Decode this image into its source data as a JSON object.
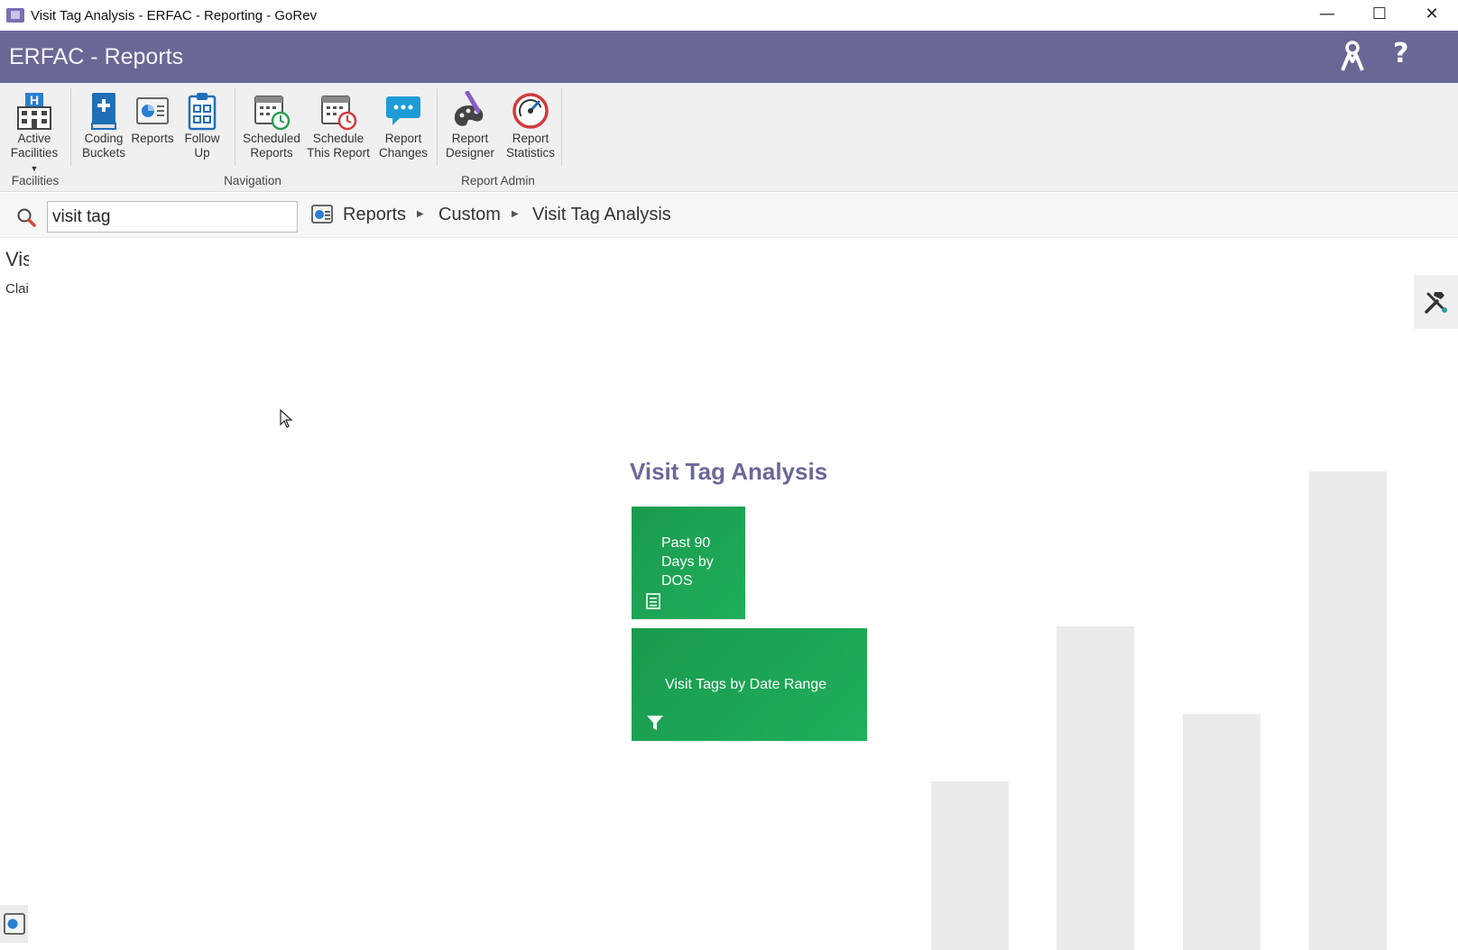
{
  "window": {
    "title": "Visit Tag Analysis - ERFAC - Reporting - GoRev",
    "controls": {
      "minimize": "—",
      "maximize": "☐",
      "close": "✕"
    }
  },
  "app_header": {
    "title": "ERFAC - Reports",
    "icons": [
      "users-icon",
      "help-icon"
    ],
    "help_glyph": "?"
  },
  "ribbon": {
    "buttons": [
      {
        "label": "Active\nFacilities",
        "icon": "hospital-icon",
        "has_dropdown": true
      },
      {
        "label": "Coding\nBuckets",
        "icon": "medical-book-icon"
      },
      {
        "label": "Reports",
        "icon": "report-icon"
      },
      {
        "label": "Follow\nUp",
        "icon": "clipboard-icon"
      },
      {
        "label": "Scheduled\nReports",
        "icon": "calendar-clock-green-icon"
      },
      {
        "label": "Schedule\nThis Report",
        "icon": "calendar-clock-red-icon"
      },
      {
        "label": "Report\nChanges",
        "icon": "chat-bubble-icon"
      },
      {
        "label": "Report\nDesigner",
        "icon": "palette-icon"
      },
      {
        "label": "Report\nStatistics",
        "icon": "gauge-icon"
      }
    ],
    "groups": [
      "Facilities",
      "Navigation",
      "Report Admin"
    ]
  },
  "search": {
    "value": "visit tag",
    "placeholder": ""
  },
  "breadcrumb": [
    "Reports",
    "Custom",
    "Visit Tag Analysis"
  ],
  "left_panel": {
    "title": "Vis",
    "subtitle": "Clai"
  },
  "main": {
    "heading": "Visit Tag Analysis",
    "tiles": [
      {
        "label": "Past 90 Days by DOS",
        "icon": "document-icon"
      },
      {
        "label": "Visit Tags by Date Range",
        "icon": "filter-icon"
      }
    ]
  },
  "colors": {
    "header_bg": "#696796",
    "tile_green": "#1faf5b",
    "heading_purple": "#6a6898"
  }
}
